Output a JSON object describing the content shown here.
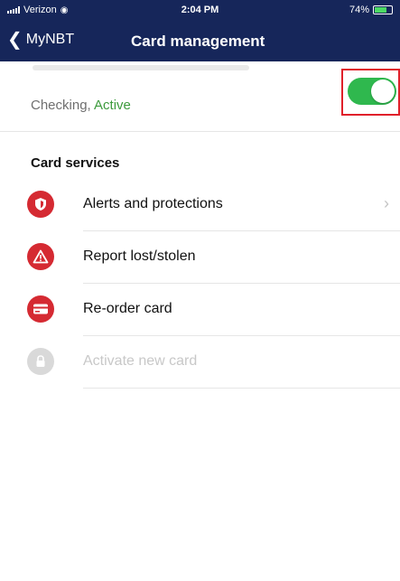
{
  "status_bar": {
    "carrier": "Verizon",
    "time": "2:04 PM",
    "battery": "74%",
    "battery_level": 0.74
  },
  "nav": {
    "back_label": "MyNBT",
    "title": "Card management"
  },
  "account": {
    "type": "Checking,",
    "status": "Active",
    "card_enabled": true
  },
  "section": {
    "title": "Card services"
  },
  "items": [
    {
      "label": "Alerts and protections",
      "icon": "shield-icon",
      "enabled": true,
      "has_chevron": true
    },
    {
      "label": "Report lost/stolen",
      "icon": "warning-icon",
      "enabled": true,
      "has_chevron": false
    },
    {
      "label": "Re-order card",
      "icon": "credit-card-icon",
      "enabled": true,
      "has_chevron": false
    },
    {
      "label": "Activate new card",
      "icon": "lock-icon",
      "enabled": false,
      "has_chevron": false
    }
  ],
  "colors": {
    "header_bg": "#16265a",
    "accent_red": "#d52a32",
    "toggle_on": "#2fb84e",
    "active_green": "#3c9a3c",
    "highlight_red": "#e0202a"
  }
}
